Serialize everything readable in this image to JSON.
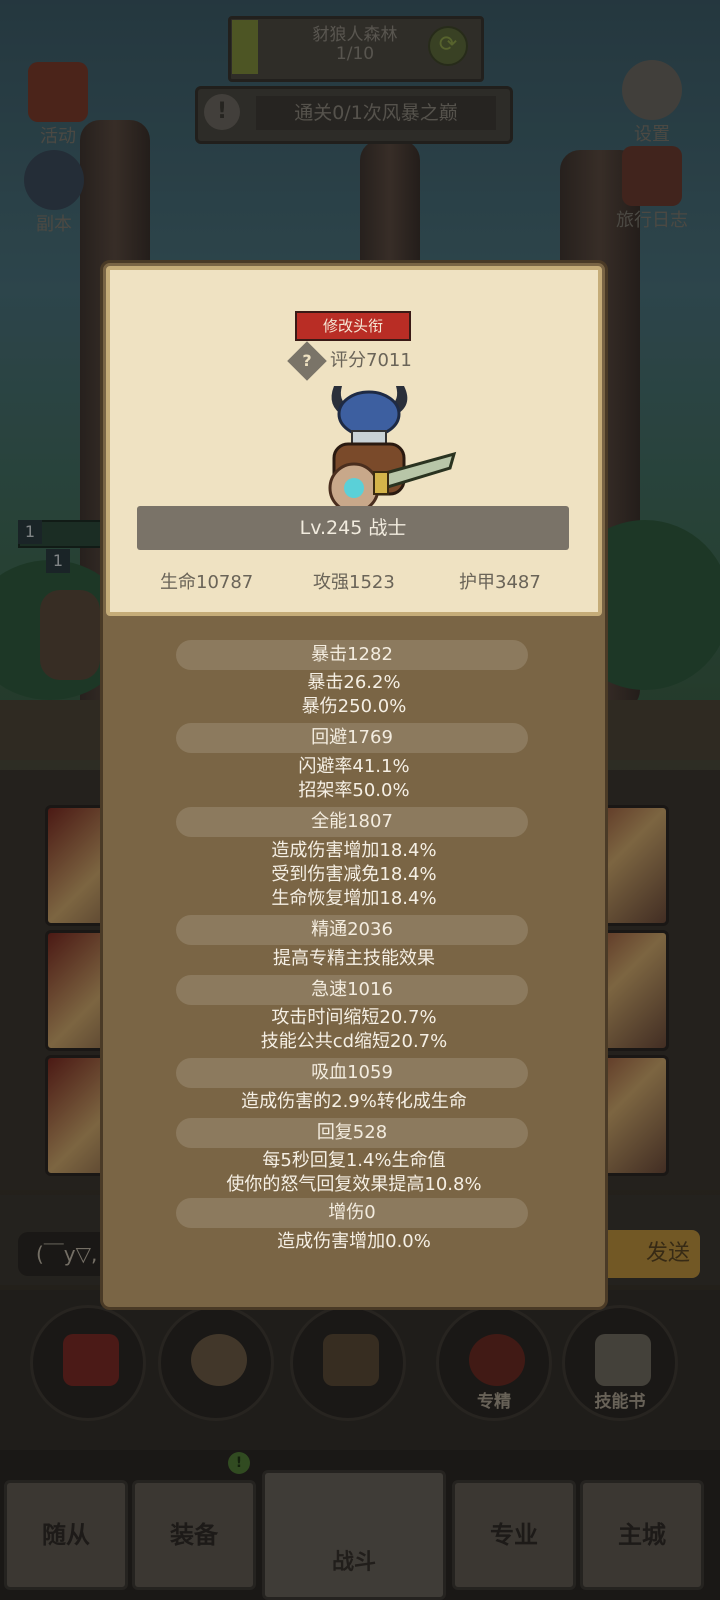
{
  "hud": {
    "stage_name": "豺狼人森林",
    "stage_progress": "1/10",
    "quest": "通关0/1次风暴之巅",
    "activity": "活动",
    "dungeon": "副本",
    "settings": "设置",
    "journal": "旅行日志"
  },
  "background": {
    "chat_placeholder": "(￣y▽,",
    "send": "发送",
    "actions": [
      "专精",
      "技能书"
    ],
    "nav": [
      "随从",
      "装备",
      "战斗",
      "专业",
      "主城"
    ],
    "nav_badge": "!",
    "row_badges": [
      "1",
      "1"
    ]
  },
  "profile": {
    "title_button": "修改头衔",
    "help": "?",
    "score": "评分7011",
    "level": "Lv.245 战士",
    "hp": "生命10787",
    "attack": "攻强1523",
    "armor": "护甲3487"
  },
  "stats": [
    {
      "header": "暴击1282",
      "lines": [
        "暴击26.2%",
        "暴伤250.0%"
      ]
    },
    {
      "header": "回避1769",
      "lines": [
        "闪避率41.1%",
        "招架率50.0%"
      ]
    },
    {
      "header": "全能1807",
      "lines": [
        "造成伤害增加18.4%",
        "受到伤害减免18.4%",
        "生命恢复增加18.4%"
      ]
    },
    {
      "header": "精通2036",
      "lines": [
        "提高专精主技能效果"
      ]
    },
    {
      "header": "急速1016",
      "lines": [
        "攻击时间缩短20.7%",
        "技能公共cd缩短20.7%"
      ]
    },
    {
      "header": "吸血1059",
      "lines": [
        "造成伤害的2.9%转化成生命"
      ]
    },
    {
      "header": "回复528",
      "lines": [
        "每5秒回复1.4%生命值",
        "使你的怒气回复效果提高10.8%"
      ]
    },
    {
      "header": "增伤0",
      "lines": [
        "造成伤害增加0.0%"
      ]
    }
  ]
}
